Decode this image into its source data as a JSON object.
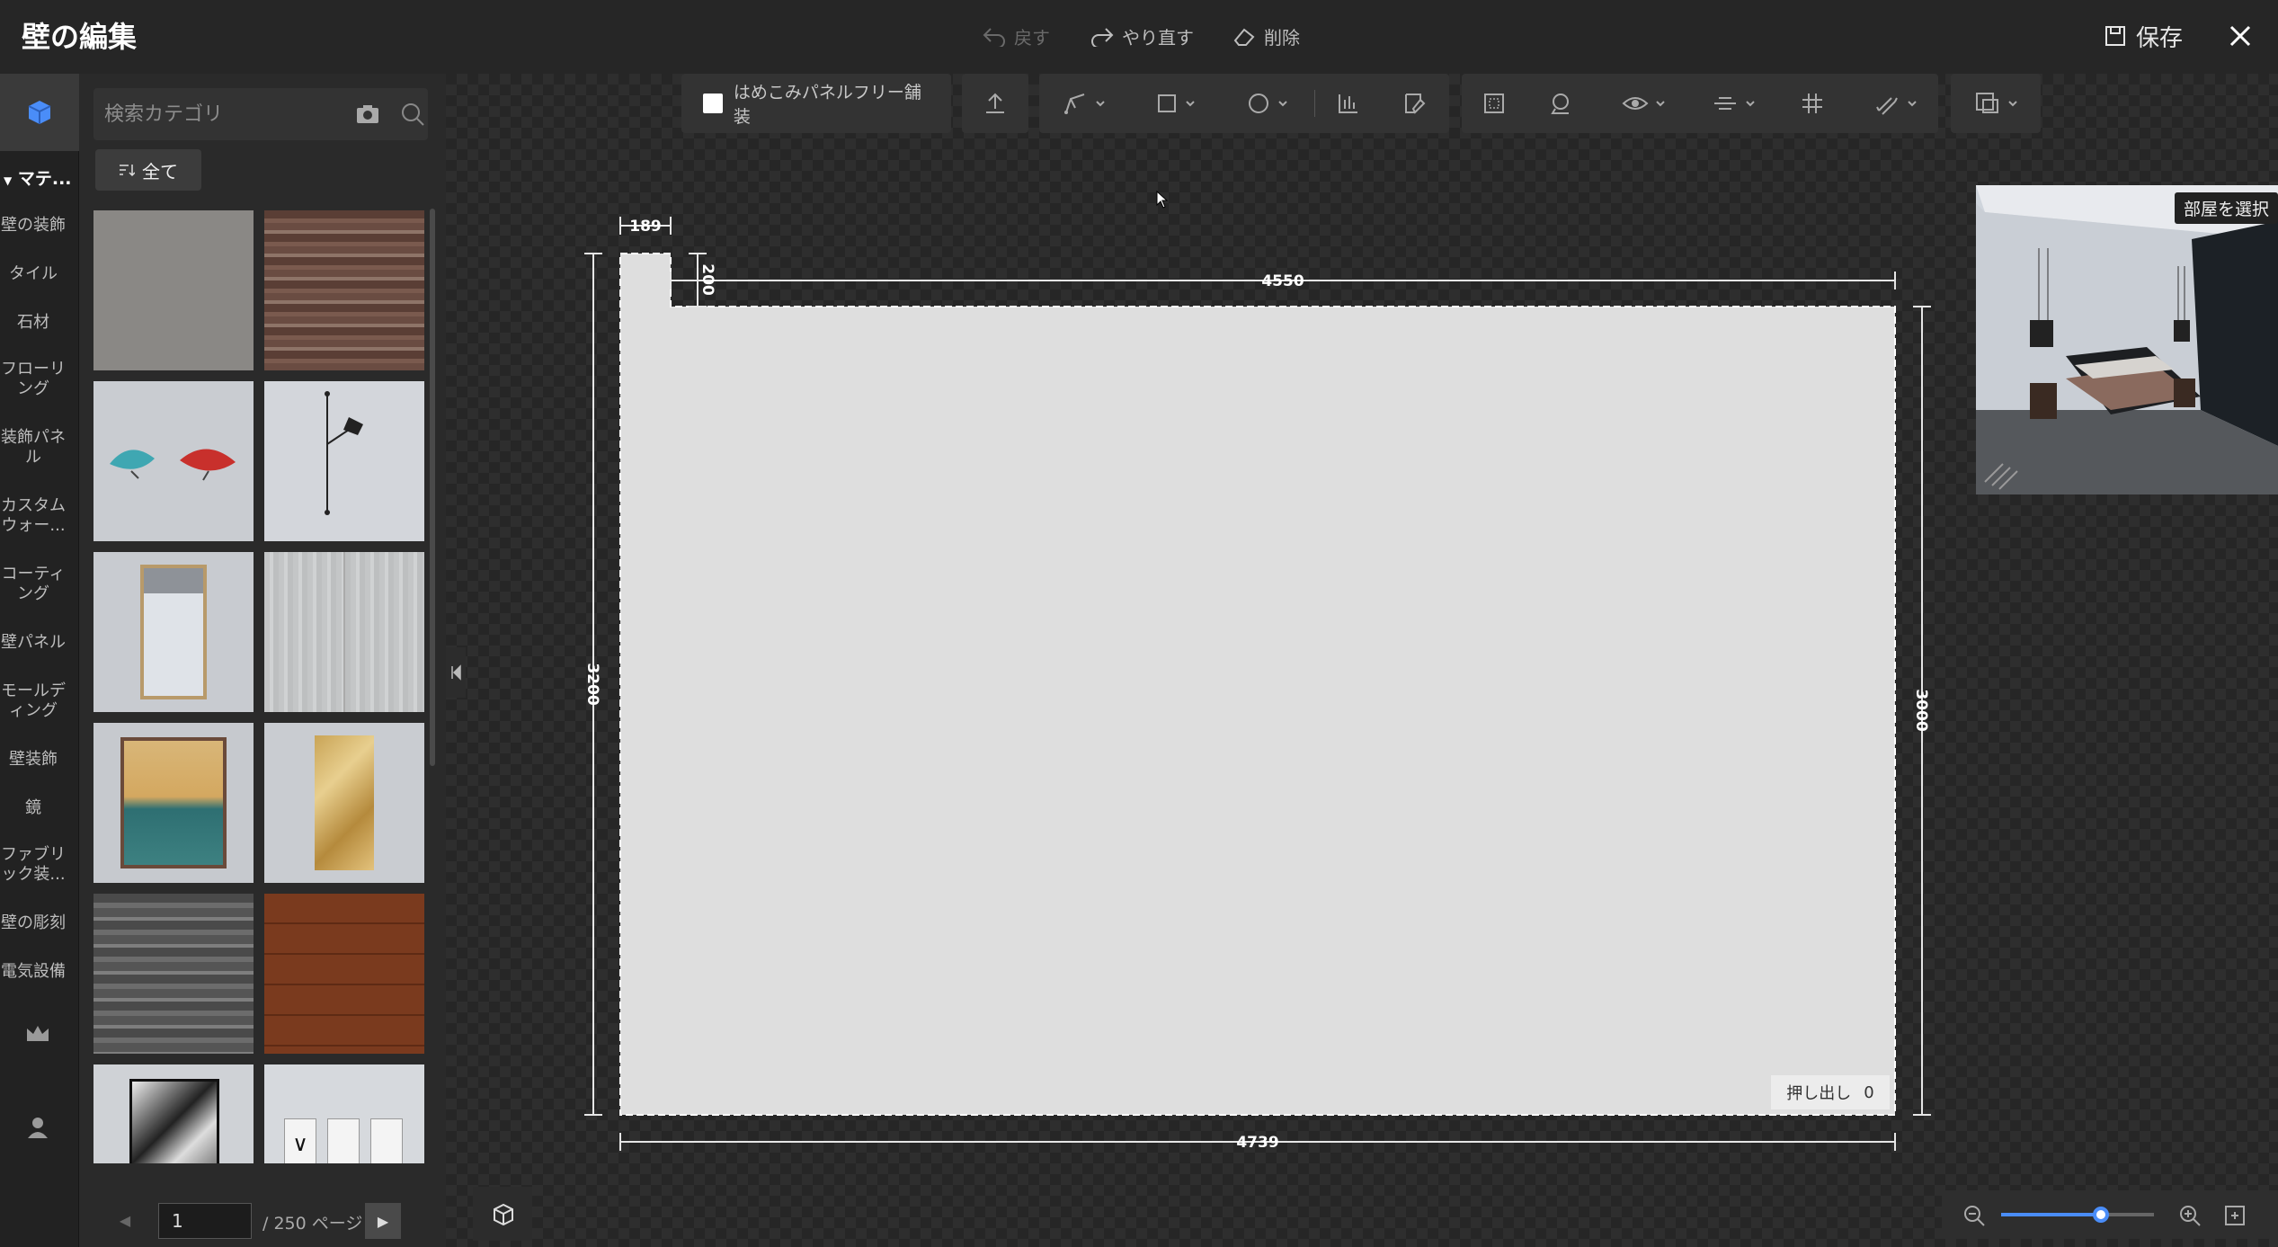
{
  "header": {
    "title": "壁の編集",
    "undo_label": "戻す",
    "redo_label": "やり直す",
    "delete_label": "削除",
    "save_label": "保存"
  },
  "rail": {
    "section_label": "マテ...",
    "items": [
      "壁の装飾",
      "タイル",
      "石材",
      "フローリング",
      "装飾パネル",
      "カスタムウォー...",
      "コーティング",
      "壁パネル",
      "モールディング",
      "壁装飾",
      "鏡",
      "ファブリック装...",
      "壁の彫刻",
      "電気設備"
    ]
  },
  "panel": {
    "search_placeholder": "検索カテゴリ",
    "filter_label": "全て",
    "thumbnails": [
      "gray-plaster",
      "dark-wood-strip",
      "fan-decor",
      "wall-lamp",
      "framed-mirror",
      "gray-marble",
      "abstract-painting",
      "gold-foil-panel",
      "gray-wood-panel",
      "red-wood-panel",
      "black-white-art",
      "icon-panels"
    ]
  },
  "pager": {
    "page": "1",
    "total_label": "/ 250 ページ"
  },
  "toolbar": {
    "freeform_label": "はめこみパネルフリー舗装"
  },
  "drawing": {
    "dim_notch_width": "189",
    "dim_notch_height": "200",
    "dim_top_width": "4550",
    "dim_left_height": "3200",
    "dim_right_height": "3000",
    "dim_bottom_width": "4739"
  },
  "preview": {
    "select_room_label": "部屋を選択"
  },
  "extrude": {
    "label": "押し出し",
    "value": "0"
  },
  "zoom": {
    "level": 0.65
  },
  "colors": {
    "accent": "#4a8df8",
    "wall_fill": "#dedede",
    "background": "#1e1e1e"
  }
}
